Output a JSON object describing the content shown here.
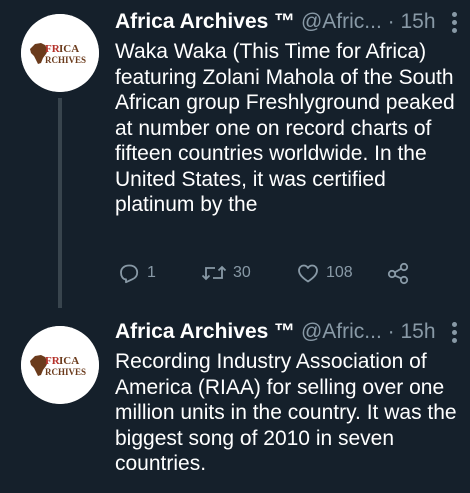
{
  "tweets": [
    {
      "avatar_text": {
        "top": "FR",
        "mid": "A",
        "brand": "AFRICA",
        "sub": "RCHIVES"
      },
      "display_name": "Africa Archives ™",
      "handle": "@Afric...",
      "separator": "·",
      "time": "15h",
      "text": "Waka Waka (This Time for Africa) featuring Zolani Mahola of the South African group Freshlyground peaked at number one on record charts of fifteen countries worldwide. In the United States, it was certified platinum by the",
      "replies": "1",
      "retweets": "30",
      "likes": "108"
    },
    {
      "display_name": "Africa Archives ™",
      "handle": "@Afric...",
      "separator": "·",
      "time": "15h",
      "text": "Recording Industry Association of America (RIAA) for selling over one million units in the country. It was the biggest song of 2010 in seven countries."
    }
  ],
  "colors": {
    "background": "#15202b",
    "secondary_text": "#8899a6",
    "thread_line": "#38444d",
    "logo_red": "#b5312a",
    "logo_brown": "#6b3b1c"
  },
  "icons": [
    "reply-icon",
    "retweet-icon",
    "like-icon",
    "share-icon",
    "more-icon"
  ]
}
